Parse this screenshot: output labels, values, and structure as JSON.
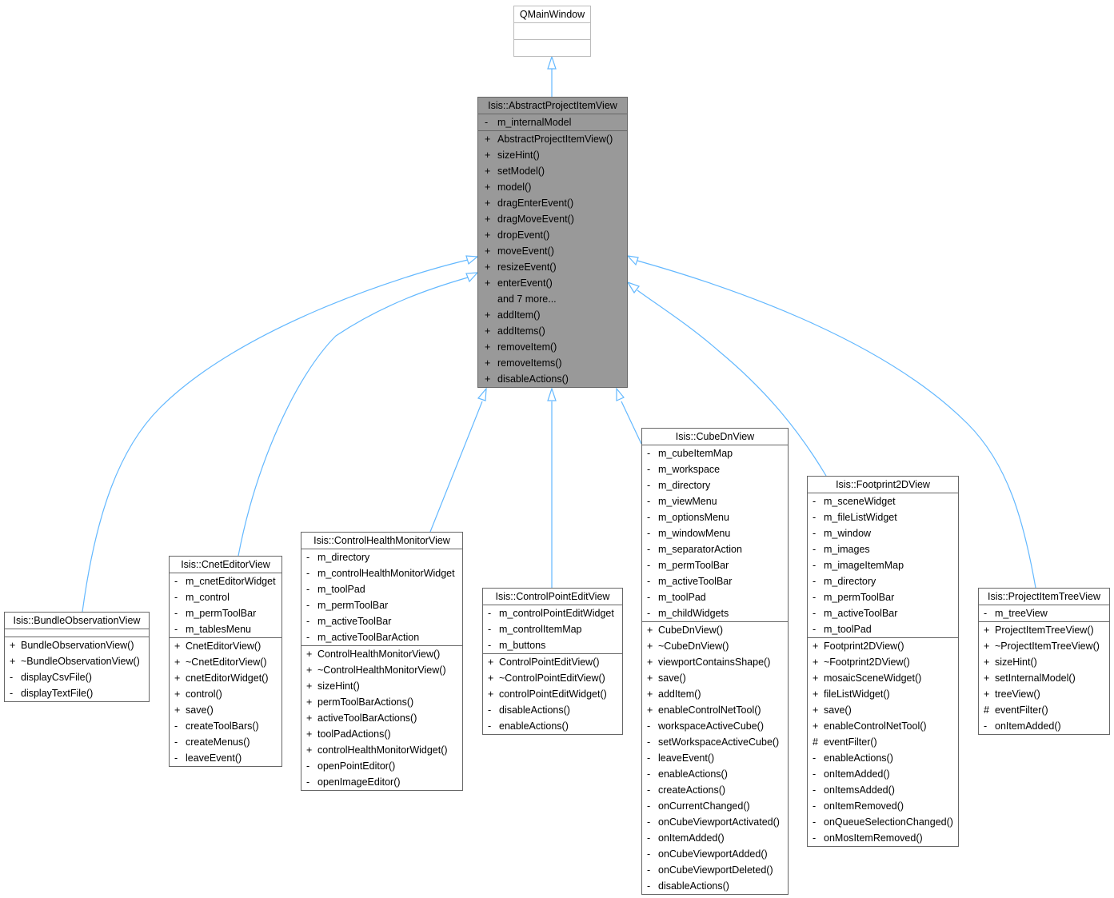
{
  "colors": {
    "edge": "#63b8ff",
    "focus_fill": "#999999",
    "border": "#666666",
    "base_border": "#bbbbbb"
  },
  "base_class": {
    "name": "QMainWindow"
  },
  "focus_class": {
    "name": "Isis::AbstractProjectItemView",
    "attributes": [
      {
        "vis": "-",
        "name": "m_internalModel"
      }
    ],
    "methods": [
      {
        "vis": "+",
        "name": "AbstractProjectItemView()"
      },
      {
        "vis": "+",
        "name": "sizeHint()"
      },
      {
        "vis": "+",
        "name": "setModel()"
      },
      {
        "vis": "+",
        "name": "model()"
      },
      {
        "vis": "+",
        "name": "dragEnterEvent()"
      },
      {
        "vis": "+",
        "name": "dragMoveEvent()"
      },
      {
        "vis": "+",
        "name": "dropEvent()"
      },
      {
        "vis": "+",
        "name": "moveEvent()"
      },
      {
        "vis": "+",
        "name": "resizeEvent()"
      },
      {
        "vis": "+",
        "name": "enterEvent()"
      },
      {
        "vis": "",
        "name": "and 7 more..."
      },
      {
        "vis": "+",
        "name": "addItem()"
      },
      {
        "vis": "+",
        "name": "addItems()"
      },
      {
        "vis": "+",
        "name": "removeItem()"
      },
      {
        "vis": "+",
        "name": "removeItems()"
      },
      {
        "vis": "+",
        "name": "disableActions()"
      }
    ]
  },
  "derived": [
    {
      "id": "bundle",
      "name": "Isis::BundleObservationView",
      "attributes": [],
      "methods": [
        {
          "vis": "+",
          "name": "BundleObservationView()"
        },
        {
          "vis": "+",
          "name": "~BundleObservationView()"
        },
        {
          "vis": "-",
          "name": "displayCsvFile()"
        },
        {
          "vis": "-",
          "name": "displayTextFile()"
        }
      ]
    },
    {
      "id": "cnet",
      "name": "Isis::CnetEditorView",
      "attributes": [
        {
          "vis": "-",
          "name": "m_cnetEditorWidget"
        },
        {
          "vis": "-",
          "name": "m_control"
        },
        {
          "vis": "-",
          "name": "m_permToolBar"
        },
        {
          "vis": "-",
          "name": "m_tablesMenu"
        }
      ],
      "methods": [
        {
          "vis": "+",
          "name": "CnetEditorView()"
        },
        {
          "vis": "+",
          "name": "~CnetEditorView()"
        },
        {
          "vis": "+",
          "name": "cnetEditorWidget()"
        },
        {
          "vis": "+",
          "name": "control()"
        },
        {
          "vis": "+",
          "name": "save()"
        },
        {
          "vis": "-",
          "name": "createToolBars()"
        },
        {
          "vis": "-",
          "name": "createMenus()"
        },
        {
          "vis": "-",
          "name": "leaveEvent()"
        }
      ]
    },
    {
      "id": "chm",
      "name": "Isis::ControlHealthMonitorView",
      "attributes": [
        {
          "vis": "-",
          "name": "m_directory"
        },
        {
          "vis": "-",
          "name": "m_controlHealthMonitorWidget"
        },
        {
          "vis": "-",
          "name": "m_toolPad"
        },
        {
          "vis": "-",
          "name": "m_permToolBar"
        },
        {
          "vis": "-",
          "name": "m_activeToolBar"
        },
        {
          "vis": "-",
          "name": "m_activeToolBarAction"
        }
      ],
      "methods": [
        {
          "vis": "+",
          "name": "ControlHealthMonitorView()"
        },
        {
          "vis": "+",
          "name": "~ControlHealthMonitorView()"
        },
        {
          "vis": "+",
          "name": "sizeHint()"
        },
        {
          "vis": "+",
          "name": "permToolBarActions()"
        },
        {
          "vis": "+",
          "name": "activeToolBarActions()"
        },
        {
          "vis": "+",
          "name": "toolPadActions()"
        },
        {
          "vis": "+",
          "name": "controlHealthMonitorWidget()"
        },
        {
          "vis": "-",
          "name": "openPointEditor()"
        },
        {
          "vis": "-",
          "name": "openImageEditor()"
        }
      ]
    },
    {
      "id": "cpe",
      "name": "Isis::ControlPointEditView",
      "attributes": [
        {
          "vis": "-",
          "name": "m_controlPointEditWidget"
        },
        {
          "vis": "-",
          "name": "m_controlItemMap"
        },
        {
          "vis": "-",
          "name": "m_buttons"
        }
      ],
      "methods": [
        {
          "vis": "+",
          "name": "ControlPointEditView()"
        },
        {
          "vis": "+",
          "name": "~ControlPointEditView()"
        },
        {
          "vis": "+",
          "name": "controlPointEditWidget()"
        },
        {
          "vis": "-",
          "name": "disableActions()"
        },
        {
          "vis": "-",
          "name": "enableActions()"
        }
      ]
    },
    {
      "id": "cube",
      "name": "Isis::CubeDnView",
      "attributes": [
        {
          "vis": "-",
          "name": "m_cubeItemMap"
        },
        {
          "vis": "-",
          "name": "m_workspace"
        },
        {
          "vis": "-",
          "name": "m_directory"
        },
        {
          "vis": "-",
          "name": "m_viewMenu"
        },
        {
          "vis": "-",
          "name": "m_optionsMenu"
        },
        {
          "vis": "-",
          "name": "m_windowMenu"
        },
        {
          "vis": "-",
          "name": "m_separatorAction"
        },
        {
          "vis": "-",
          "name": "m_permToolBar"
        },
        {
          "vis": "-",
          "name": "m_activeToolBar"
        },
        {
          "vis": "-",
          "name": "m_toolPad"
        },
        {
          "vis": "-",
          "name": "m_childWidgets"
        }
      ],
      "methods": [
        {
          "vis": "+",
          "name": "CubeDnView()"
        },
        {
          "vis": "+",
          "name": "~CubeDnView()"
        },
        {
          "vis": "+",
          "name": "viewportContainsShape()"
        },
        {
          "vis": "+",
          "name": "save()"
        },
        {
          "vis": "+",
          "name": "addItem()"
        },
        {
          "vis": "+",
          "name": "enableControlNetTool()"
        },
        {
          "vis": "-",
          "name": "workspaceActiveCube()"
        },
        {
          "vis": "-",
          "name": "setWorkspaceActiveCube()"
        },
        {
          "vis": "-",
          "name": "leaveEvent()"
        },
        {
          "vis": "-",
          "name": "enableActions()"
        },
        {
          "vis": "-",
          "name": "createActions()"
        },
        {
          "vis": "-",
          "name": "onCurrentChanged()"
        },
        {
          "vis": "-",
          "name": "onCubeViewportActivated()"
        },
        {
          "vis": "-",
          "name": "onItemAdded()"
        },
        {
          "vis": "-",
          "name": "onCubeViewportAdded()"
        },
        {
          "vis": "-",
          "name": "onCubeViewportDeleted()"
        },
        {
          "vis": "-",
          "name": "disableActions()"
        }
      ]
    },
    {
      "id": "foot",
      "name": "Isis::Footprint2DView",
      "attributes": [
        {
          "vis": "-",
          "name": "m_sceneWidget"
        },
        {
          "vis": "-",
          "name": "m_fileListWidget"
        },
        {
          "vis": "-",
          "name": "m_window"
        },
        {
          "vis": "-",
          "name": "m_images"
        },
        {
          "vis": "-",
          "name": "m_imageItemMap"
        },
        {
          "vis": "-",
          "name": "m_directory"
        },
        {
          "vis": "-",
          "name": "m_permToolBar"
        },
        {
          "vis": "-",
          "name": "m_activeToolBar"
        },
        {
          "vis": "-",
          "name": "m_toolPad"
        }
      ],
      "methods": [
        {
          "vis": "+",
          "name": "Footprint2DView()"
        },
        {
          "vis": "+",
          "name": "~Footprint2DView()"
        },
        {
          "vis": "+",
          "name": "mosaicSceneWidget()"
        },
        {
          "vis": "+",
          "name": "fileListWidget()"
        },
        {
          "vis": "+",
          "name": "save()"
        },
        {
          "vis": "+",
          "name": "enableControlNetTool()"
        },
        {
          "vis": "#",
          "name": "eventFilter()"
        },
        {
          "vis": "-",
          "name": "enableActions()"
        },
        {
          "vis": "-",
          "name": "onItemAdded()"
        },
        {
          "vis": "-",
          "name": "onItemsAdded()"
        },
        {
          "vis": "-",
          "name": "onItemRemoved()"
        },
        {
          "vis": "-",
          "name": "onQueueSelectionChanged()"
        },
        {
          "vis": "-",
          "name": "onMosItemRemoved()"
        }
      ]
    },
    {
      "id": "pitv",
      "name": "Isis::ProjectItemTreeView",
      "attributes": [
        {
          "vis": "-",
          "name": "m_treeView"
        }
      ],
      "methods": [
        {
          "vis": "+",
          "name": "ProjectItemTreeView()"
        },
        {
          "vis": "+",
          "name": "~ProjectItemTreeView()"
        },
        {
          "vis": "+",
          "name": "sizeHint()"
        },
        {
          "vis": "+",
          "name": "setInternalModel()"
        },
        {
          "vis": "+",
          "name": "treeView()"
        },
        {
          "vis": "#",
          "name": "eventFilter()"
        },
        {
          "vis": "-",
          "name": "onItemAdded()"
        }
      ]
    }
  ]
}
